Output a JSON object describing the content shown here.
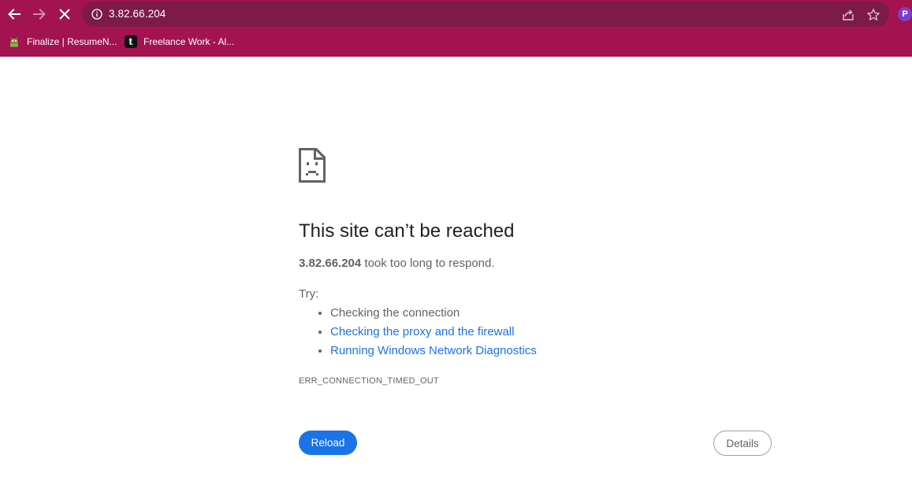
{
  "toolbar": {
    "back_icon": "arrow-left-icon",
    "forward_icon": "arrow-right-icon",
    "stop_icon": "close-icon",
    "url": "3.82.66.204",
    "site_info_icon": "info-icon",
    "share_icon": "share-icon",
    "bookmark_star_icon": "star-icon",
    "profile_initial": "P",
    "theme_color": "#a2134f",
    "omnibox_color": "#7c1a48"
  },
  "bookmarks": [
    {
      "label": "Finalize | ResumeN...",
      "icon": "android-robot-icon"
    },
    {
      "label": "Freelance Work - Al...",
      "icon": "t-logo-icon"
    }
  ],
  "error": {
    "icon": "sad-page-icon",
    "title": "This site can’t be reached",
    "host": "3.82.66.204",
    "message": " took too long to respond.",
    "try_label": "Try:",
    "suggestions": [
      {
        "text": "Checking the connection",
        "link": false
      },
      {
        "text": "Checking the proxy and the firewall",
        "link": true
      },
      {
        "text": "Running Windows Network Diagnostics",
        "link": true
      }
    ],
    "code": "ERR_CONNECTION_TIMED_OUT"
  },
  "buttons": {
    "reload_label": "Reload",
    "details_label": "Details",
    "accent_color": "#1a73e8"
  }
}
